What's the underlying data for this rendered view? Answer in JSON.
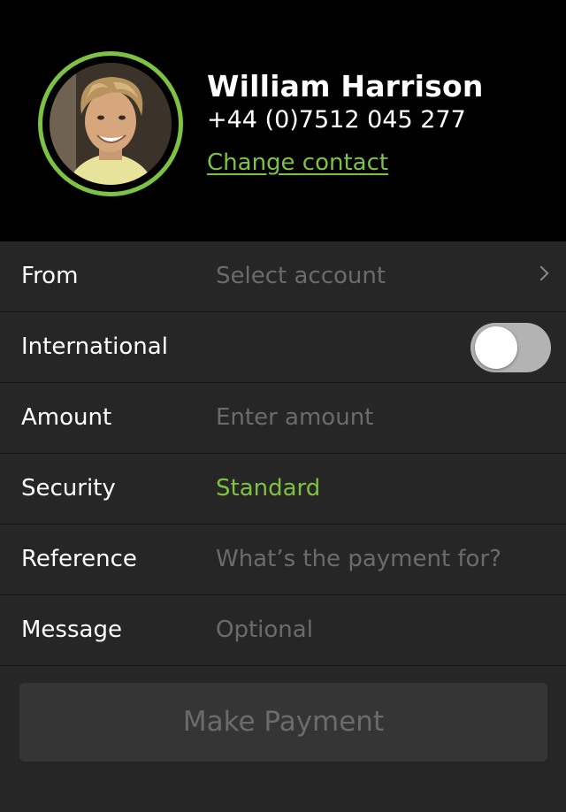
{
  "contact": {
    "name": "William Harrison",
    "phone": "+44 (0)7512 045 277",
    "change_label": "Change contact",
    "avatar_ring_color": "#7dc242"
  },
  "form": {
    "from": {
      "label": "From",
      "placeholder": "Select account",
      "icon": "chevron-right-icon"
    },
    "international": {
      "label": "International",
      "toggle_on": false
    },
    "amount": {
      "label": "Amount",
      "placeholder": "Enter amount"
    },
    "security": {
      "label": "Security",
      "value": "Standard",
      "value_color": "#7dc242"
    },
    "reference": {
      "label": "Reference",
      "placeholder": "What’s the payment for?"
    },
    "message": {
      "label": "Message",
      "placeholder": "Optional"
    }
  },
  "actions": {
    "make_payment_label": "Make Payment"
  }
}
